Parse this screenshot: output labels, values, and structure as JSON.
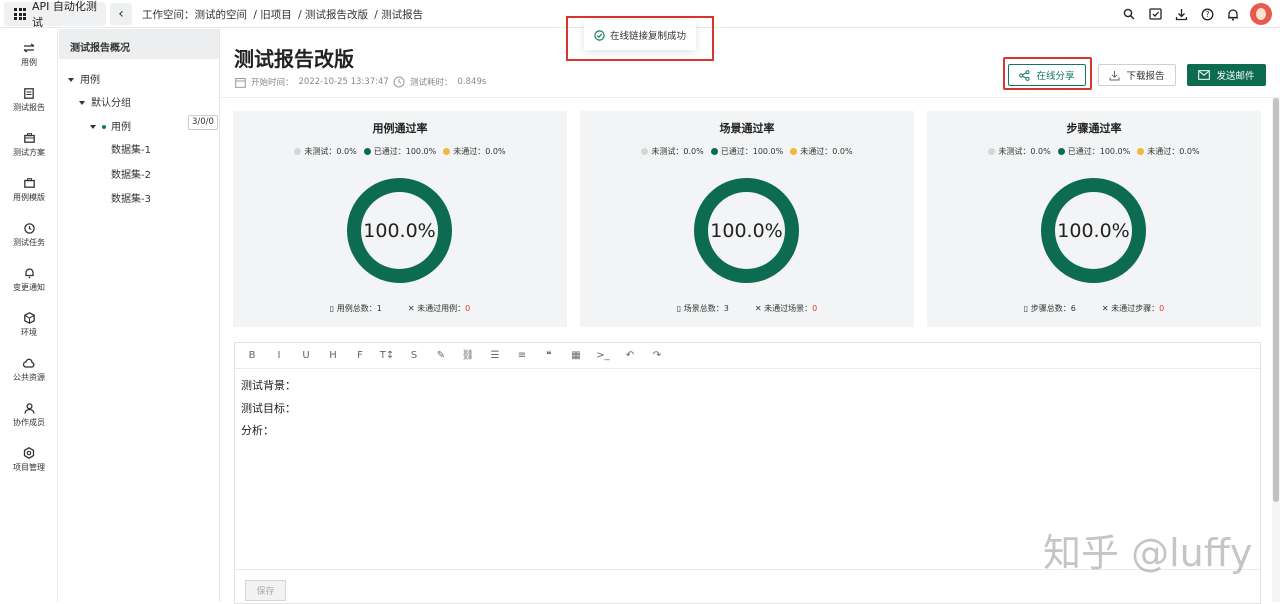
{
  "app": {
    "name": "API 自动化测试"
  },
  "breadcrumb": [
    "工作空间：测试的空间",
    "/ 旧项目",
    "/ 测试报告改版",
    "/ 测试报告"
  ],
  "nav": [
    "用例",
    "测试报告",
    "测试方案",
    "用例模版",
    "测试任务",
    "变更通知",
    "环境",
    "公共资源",
    "协作成员",
    "项目管理"
  ],
  "tree": {
    "header": "测试报告概况",
    "root": "用例",
    "group": "默认分组",
    "case": "用例",
    "case_count": "3/0/0",
    "datasets": [
      "数据集-1",
      "数据集-2",
      "数据集-3"
    ]
  },
  "report": {
    "title": "测试报告改版",
    "start_label": "开始时间：",
    "start_value": "2022-10-25 13:37:47",
    "duration_label": "测试耗时：",
    "duration_value": "0.849s"
  },
  "buttons": {
    "share": "在线分享",
    "download": "下载报告",
    "mail": "发送邮件"
  },
  "toast": "在线链接复制成功",
  "colors": {
    "primary": "#0d6b50",
    "untested": "#d6d6d6",
    "passed": "#0c6b50",
    "failed": "#f0b841",
    "alert": "#d9352c"
  },
  "cards": [
    {
      "title": "用例通过率",
      "legend": [
        {
          "label": "未测试：0.0%"
        },
        {
          "label": "已通过：100.0%"
        },
        {
          "label": "未通过：0.0%"
        }
      ],
      "rate": "100.0%",
      "rate_value": 100.0,
      "total": "用例总数：1",
      "failed_label": "未通过用例：",
      "failed_value": "0"
    },
    {
      "title": "场景通过率",
      "legend": [
        {
          "label": "未测试：0.0%"
        },
        {
          "label": "已通过：100.0%"
        },
        {
          "label": "未通过：0.0%"
        }
      ],
      "rate": "100.0%",
      "rate_value": 100.0,
      "total": "场景总数：3",
      "failed_label": "未通过场景：",
      "failed_value": "0"
    },
    {
      "title": "步骤通过率",
      "legend": [
        {
          "label": "未测试：0.0%"
        },
        {
          "label": "已通过：100.0%"
        },
        {
          "label": "未通过：0.0%"
        }
      ],
      "rate": "100.0%",
      "rate_value": 100.0,
      "total": "步骤总数：6",
      "failed_label": "未通过步骤：",
      "failed_value": "0"
    }
  ],
  "editor": {
    "toolbar_icons": [
      "bold-icon",
      "italic-icon",
      "underline-icon",
      "heading-icon",
      "clear-format-icon",
      "font-size-icon",
      "strikethrough-icon",
      "brush-icon",
      "link-icon",
      "bullet-list-icon",
      "align-icon",
      "quote-icon",
      "table-icon",
      "code-icon",
      "undo-icon",
      "redo-icon"
    ],
    "toolbar_glyphs": [
      "B",
      "I",
      "U",
      "H",
      "F",
      "T↕",
      "S",
      "✎",
      "⛓",
      "☰",
      "≡",
      "❝",
      "▦",
      ">_",
      "↶",
      "↷"
    ],
    "lines": [
      "测试背景：",
      "测试目标：",
      "分析："
    ],
    "save": "保存"
  },
  "watermark": "知乎 @luffy"
}
